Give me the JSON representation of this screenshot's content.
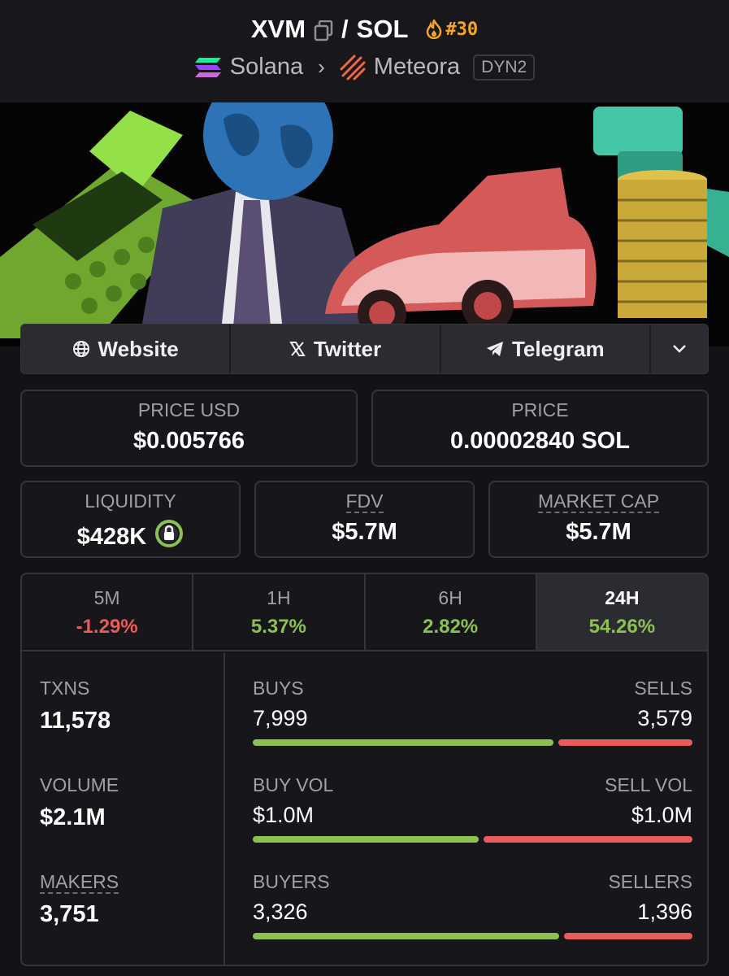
{
  "header": {
    "base_symbol": "XVM",
    "slash": "/",
    "quote_symbol": "SOL",
    "rank": "#30",
    "chain": "Solana",
    "dex": "Meteora",
    "dex_badge": "DYN2"
  },
  "links": [
    {
      "label": "Website",
      "icon": "globe-icon"
    },
    {
      "label": "Twitter",
      "icon": "x-logo-icon"
    },
    {
      "label": "Telegram",
      "icon": "telegram-icon"
    }
  ],
  "price_usd": {
    "label": "PRICE USD",
    "value": "$0.005766"
  },
  "price_native": {
    "label": "PRICE",
    "value": "0.00002840 SOL"
  },
  "liquidity": {
    "label": "LIQUIDITY",
    "value": "$428K"
  },
  "fdv": {
    "label": "FDV",
    "value": "$5.7M"
  },
  "market_cap": {
    "label": "MARKET CAP",
    "value": "$5.7M"
  },
  "tabs": [
    {
      "label": "5M",
      "value": "-1.29%"
    },
    {
      "label": "1H",
      "value": "5.37%"
    },
    {
      "label": "6H",
      "value": "2.82%"
    },
    {
      "label": "24H",
      "value": "54.26%"
    }
  ],
  "metrics": {
    "txns": {
      "label": "TXNS",
      "value": "11,578"
    },
    "volume": {
      "label": "VOLUME",
      "value": "$2.1M"
    },
    "makers": {
      "label": "MAKERS",
      "value": "3,751"
    }
  },
  "split_bars": [
    {
      "left_label": "BUYS",
      "right_label": "SELLS",
      "left_value": "7,999",
      "right_value": "3,579",
      "left_share": 0.691
    },
    {
      "left_label": "BUY VOL",
      "right_label": "SELL VOL",
      "left_value": "$1.0M",
      "right_value": "$1.0M",
      "left_share": 0.52
    },
    {
      "left_label": "BUYERS",
      "right_label": "SELLERS",
      "left_value": "3,326",
      "right_value": "1,396",
      "left_share": 0.704
    }
  ],
  "colors": {
    "positive": "#8cc152",
    "negative": "#ea5b5b",
    "rank": "#f5a623"
  }
}
